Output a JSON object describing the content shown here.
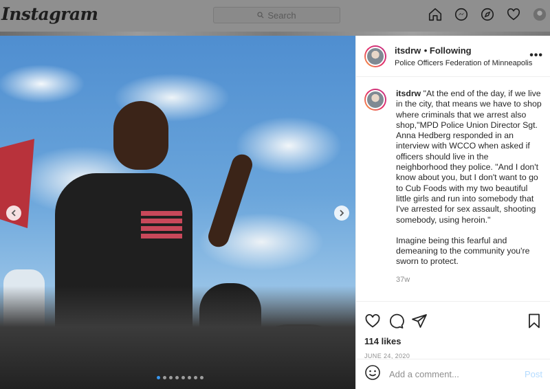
{
  "nav": {
    "logo": "Instagram",
    "search_placeholder": "Search",
    "icons": [
      "home-icon",
      "messenger-icon",
      "explore-icon",
      "heart-icon",
      "profile-avatar"
    ]
  },
  "post": {
    "username": "itsdrw",
    "follow_status": "Following",
    "location": "Police Officers Federation of Minneapolis",
    "caption_quote": "\"At the end of the day, if we live in the city, that means we have to shop where criminals that we arrest also shop,\"MPD Police Union Director Sgt. Anna Hedberg responded in an interview with WCCO when asked if officers should live in the neighborhood they police. \"And I don't know about you, but I don't want to go to Cub Foods with my two beautiful little girls and run into somebody that I've arrested for sex assault, shooting somebody, using heroin.\"",
    "caption_second": "Imagine being this fearful and demeaning to the community you're sworn to protect.",
    "time_ago": "37w",
    "likes": "114 likes",
    "date": "JUNE 24, 2020",
    "comment_placeholder": "Add a comment...",
    "post_button": "Post",
    "carousel_slides": 8,
    "carousel_active": 1
  },
  "colors": {
    "accent": "#3897f0",
    "post_button_disabled": "#b3dbff",
    "secondary_text": "#8e8e8e",
    "overlay": "#8a8a8a"
  }
}
